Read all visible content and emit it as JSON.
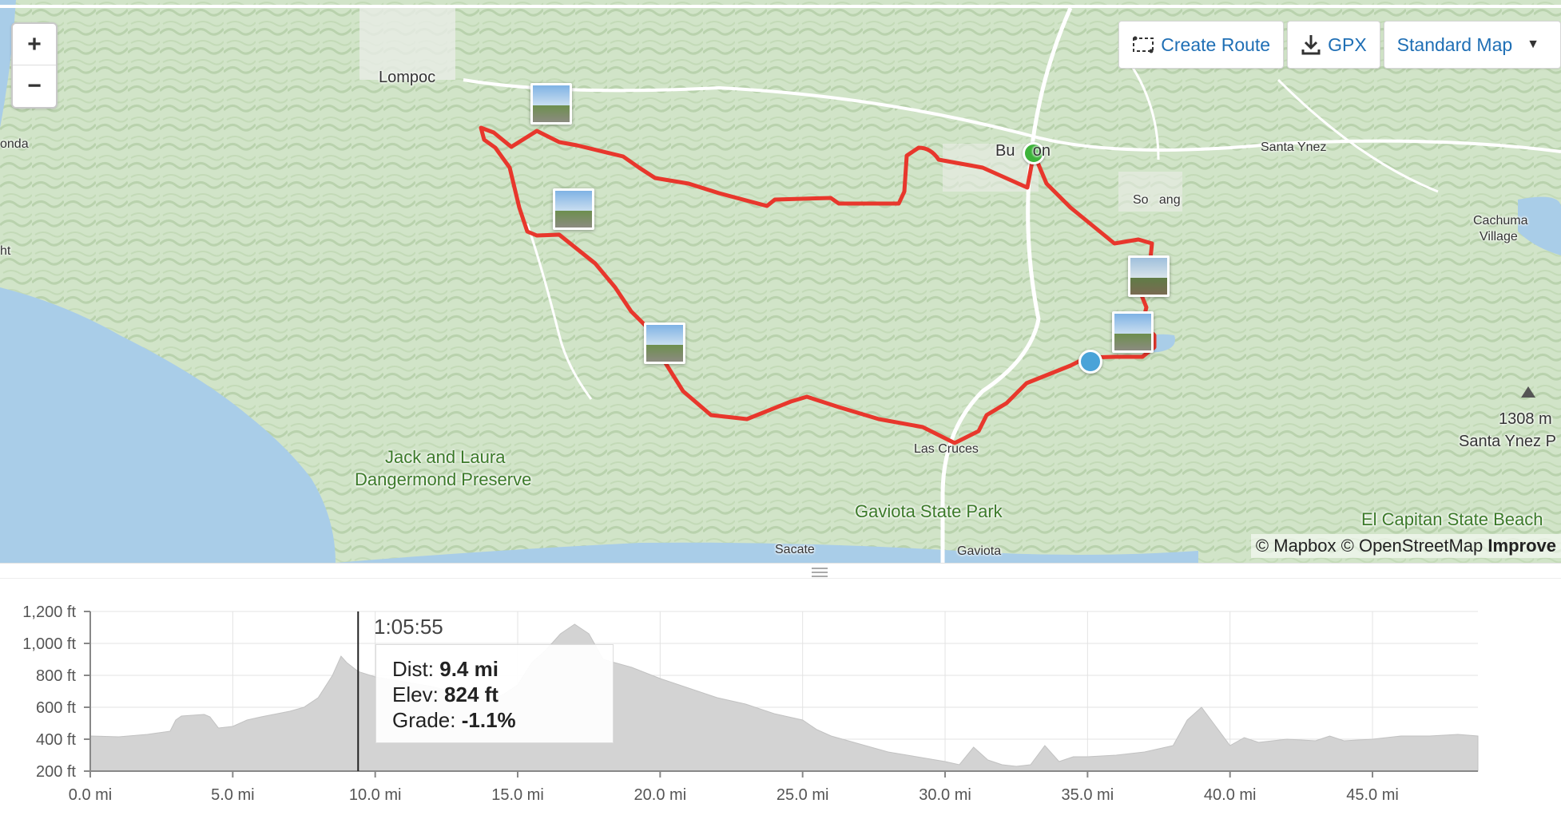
{
  "toolbar": {
    "create_route_label": "Create Route",
    "gpx_label": "GPX",
    "map_style_label": "Standard Map"
  },
  "zoom": {
    "in_label": "+",
    "out_label": "−"
  },
  "map": {
    "places": [
      {
        "name": "Lompoc",
        "style": "town"
      },
      {
        "name": "onda",
        "style": "small"
      },
      {
        "name": "ht",
        "style": "small"
      },
      {
        "name": "Buellton",
        "style": "town",
        "display": "Bu    on"
      },
      {
        "name": "Santa Ynez",
        "style": "small"
      },
      {
        "name": "Solvang",
        "style": "small",
        "display": "So   ang"
      },
      {
        "name": "Cachuma",
        "style": "small"
      },
      {
        "name": "Village",
        "style": "small"
      },
      {
        "name": "Las Cruces",
        "style": "small"
      },
      {
        "name": "Sacate",
        "style": "small"
      },
      {
        "name": "Gaviota",
        "style": "small"
      },
      {
        "name": "1308 m",
        "style": "town"
      },
      {
        "name": "Santa Ynez P",
        "style": "town"
      },
      {
        "name": "Jack and Laura",
        "style": "park"
      },
      {
        "name": "Dangermond Preserve",
        "style": "park"
      },
      {
        "name": "Gaviota State Park",
        "style": "park"
      },
      {
        "name": "El Capitan State Beach",
        "style": "park"
      }
    ],
    "attribution": {
      "mapbox": "© Mapbox",
      "osm": "© OpenStreetMap",
      "improve": "Improve"
    },
    "colors": {
      "route": "#e8372c",
      "start": "#3db33a",
      "position": "#4aa3d8",
      "water": "#a9cde8",
      "land": "#d4e6cb"
    }
  },
  "tooltip": {
    "time": "1:05:55",
    "dist_label": "Dist:",
    "dist_value": "9.4 mi",
    "elev_label": "Elev:",
    "elev_value": "824 ft",
    "grade_label": "Grade:",
    "grade_value": "-1.1%"
  },
  "chart_data": {
    "type": "area",
    "xlabel": "",
    "ylabel": "",
    "x_ticks": [
      "0.0 mi",
      "5.0 mi",
      "10.0 mi",
      "15.0 mi",
      "20.0 mi",
      "25.0 mi",
      "30.0 mi",
      "35.0 mi",
      "40.0 mi",
      "45.0 mi"
    ],
    "y_ticks": [
      "200 ft",
      "400 ft",
      "600 ft",
      "800 ft",
      "1,000 ft",
      "1,200 ft"
    ],
    "xlim": [
      0,
      48.7
    ],
    "ylim": [
      200,
      1200
    ],
    "cursor_x": 9.4,
    "grid": true,
    "series": [
      {
        "x": [
          0,
          1,
          2,
          2.8,
          3,
          3.2,
          4,
          4.2,
          4.5,
          5,
          5.5,
          6,
          7,
          7.5,
          8,
          8.5,
          8.8,
          9,
          9.4,
          10,
          11,
          12,
          13,
          14,
          14.5,
          15,
          15.5,
          16,
          16.5,
          17,
          17.5,
          18,
          19,
          20,
          21,
          22,
          23,
          24,
          25,
          25.5,
          26,
          27,
          28,
          29,
          30,
          30.5,
          31,
          31.5,
          32,
          32.5,
          33,
          33.5,
          34,
          34.5,
          35,
          36,
          37,
          38,
          38.5,
          39,
          39.5,
          40,
          40.5,
          41,
          42,
          43,
          43.5,
          44,
          45,
          46,
          47,
          48,
          48.7
        ],
        "y": [
          420,
          415,
          430,
          450,
          520,
          545,
          555,
          540,
          470,
          480,
          520,
          540,
          575,
          600,
          660,
          800,
          920,
          880,
          824,
          790,
          760,
          730,
          680,
          640,
          680,
          740,
          880,
          960,
          1060,
          1120,
          1060,
          900,
          850,
          780,
          720,
          660,
          620,
          560,
          520,
          460,
          420,
          370,
          320,
          290,
          260,
          240,
          350,
          270,
          240,
          230,
          240,
          360,
          260,
          290,
          290,
          300,
          320,
          360,
          520,
          600,
          480,
          360,
          410,
          380,
          400,
          390,
          420,
          390,
          400,
          420,
          420,
          430,
          420
        ]
      }
    ]
  }
}
